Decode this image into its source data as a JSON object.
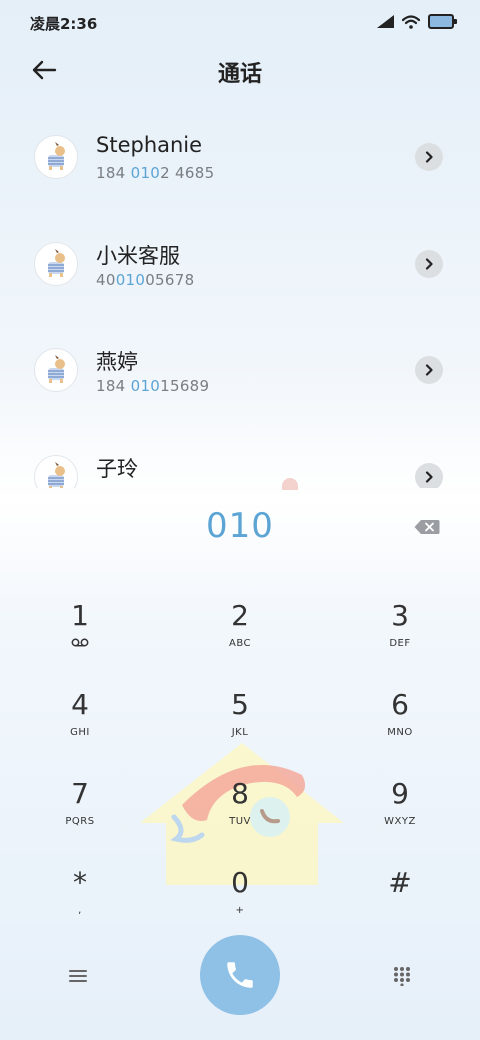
{
  "status_bar": {
    "time": "凌晨2:36"
  },
  "header": {
    "title": "通话"
  },
  "contacts": [
    {
      "name": "Stephanie",
      "number_pre": "184 ",
      "number_hl": "010",
      "number_post": "2 4685"
    },
    {
      "name": "小米客服",
      "number_pre": "40",
      "number_hl": "010",
      "number_post": "05678"
    },
    {
      "name": "燕婷",
      "number_pre": "184 ",
      "number_hl": "010",
      "number_post": "15689"
    },
    {
      "name": "子玲",
      "number_pre": "",
      "number_hl": "",
      "number_post": ""
    }
  ],
  "dial": {
    "input": "010"
  },
  "keypad": [
    {
      "digit": "1",
      "letters": ""
    },
    {
      "digit": "2",
      "letters": "ABC"
    },
    {
      "digit": "3",
      "letters": "DEF"
    },
    {
      "digit": "4",
      "letters": "GHI"
    },
    {
      "digit": "5",
      "letters": "JKL"
    },
    {
      "digit": "6",
      "letters": "MNO"
    },
    {
      "digit": "7",
      "letters": "PQRS"
    },
    {
      "digit": "8",
      "letters": "TUV"
    },
    {
      "digit": "9",
      "letters": "WXYZ"
    },
    {
      "digit": "*",
      "letters": ","
    },
    {
      "digit": "0",
      "letters": "+"
    },
    {
      "digit": "#",
      "letters": ""
    }
  ],
  "icons": {
    "back": "arrow-left-icon",
    "detail": "chevron-right-icon",
    "backspace": "backspace-icon",
    "voicemail": "voicemail-icon",
    "menu": "menu-icon",
    "call": "phone-icon",
    "dialpad": "dialpad-icon"
  },
  "colors": {
    "accent": "#5ba4d4",
    "call_button": "#8fc0e6"
  }
}
